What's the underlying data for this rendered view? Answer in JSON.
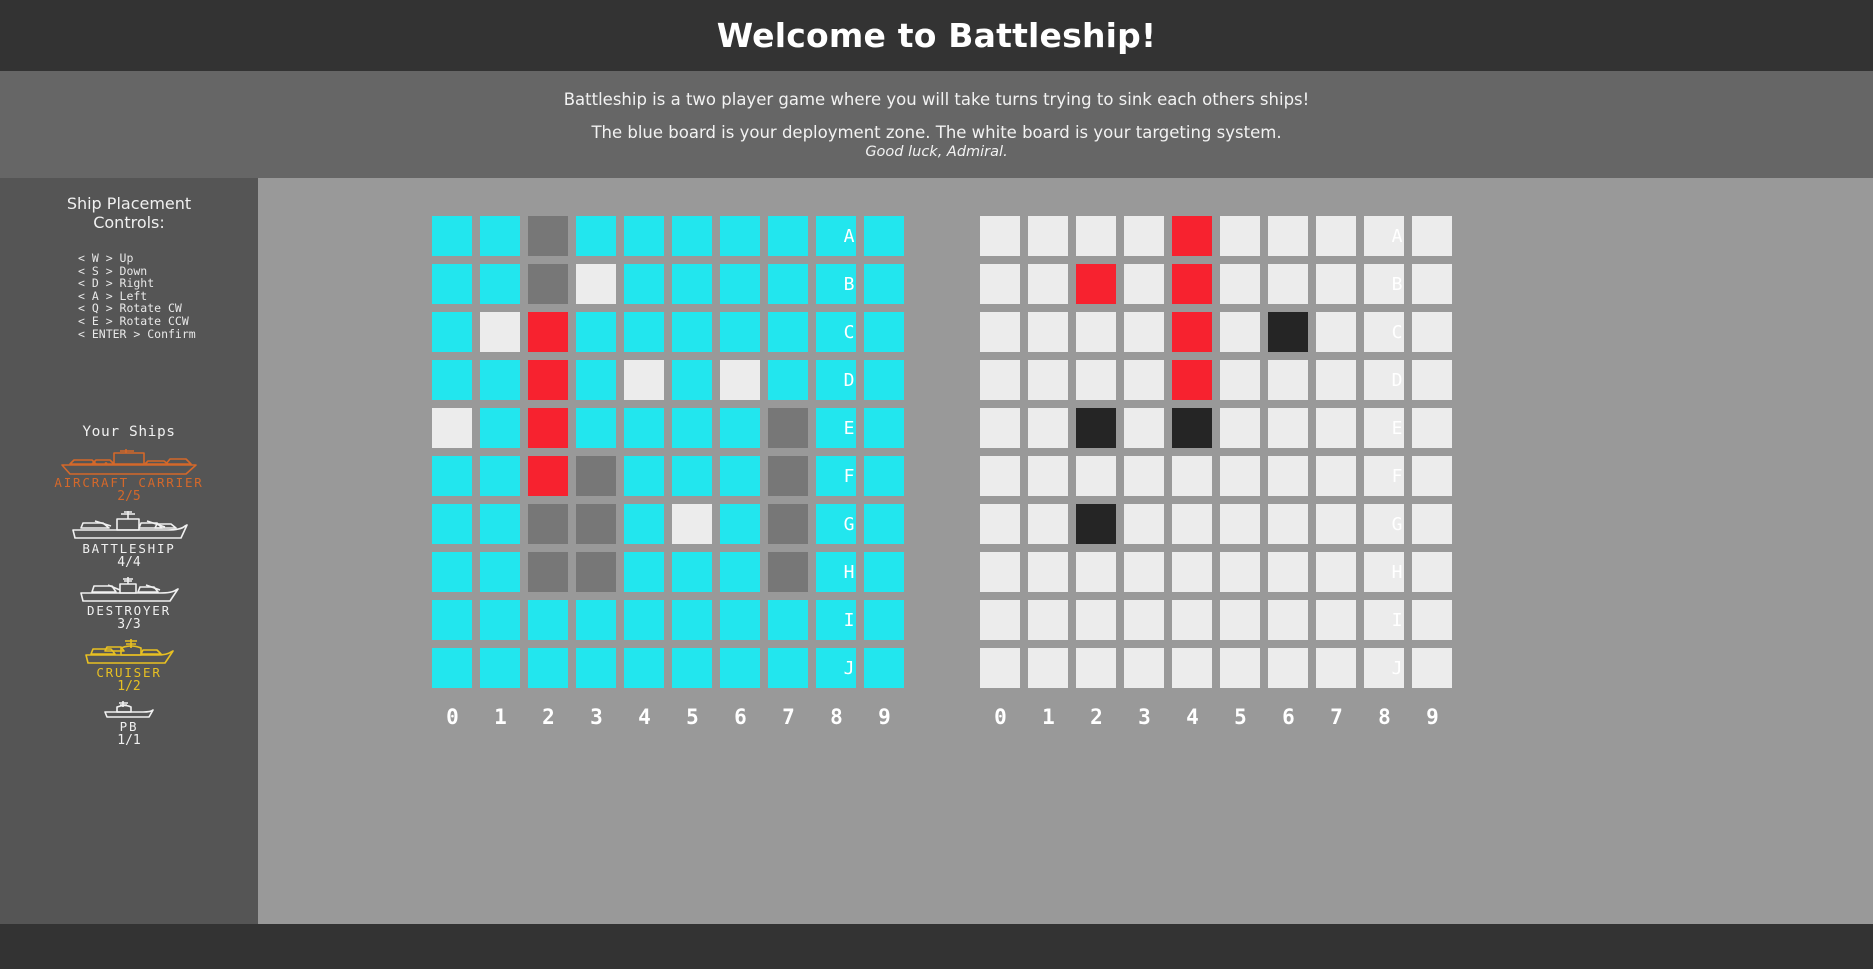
{
  "header": {
    "title": "Welcome to Battleship!"
  },
  "banner": {
    "line1": "Battleship is a two player game where you will take turns trying to sink each others ships!",
    "line2": "The blue board is your deployment zone. The white board is your targeting system.",
    "line3": "Good luck, Admiral."
  },
  "sidebar": {
    "controls_title": "Ship Placement\nControls:",
    "controls_title_line1": "Ship Placement",
    "controls_title_line2": "Controls:",
    "controls": [
      "< W > Up",
      "< S > Down",
      "< D > Right",
      "< A > Left",
      "< Q > Rotate CW",
      "< E > Rotate CCW",
      "< ENTER > Confirm"
    ],
    "ships_title": "Your Ships",
    "ships": [
      {
        "name": "AIRCRAFT CARRIER",
        "count": "2/5",
        "color": "#d4682a",
        "icon": "aircraft-carrier-icon"
      },
      {
        "name": "BATTLESHIP",
        "count": "4/4",
        "color": "#f0f0f0",
        "icon": "battleship-icon"
      },
      {
        "name": "DESTROYER",
        "count": "3/3",
        "color": "#f0f0f0",
        "icon": "destroyer-icon"
      },
      {
        "name": "CRUISER",
        "count": "1/2",
        "color": "#e8c022",
        "icon": "cruiser-icon"
      },
      {
        "name": "PB",
        "count": "1/1",
        "color": "#f0f0f0",
        "icon": "patrol-boat-icon"
      }
    ]
  },
  "colors": {
    "water": "#22e6ee",
    "ship": "#777777",
    "hit": "#f7222f",
    "miss": "#ececec",
    "sunk": "#252525",
    "board_bg": "#999999",
    "header_bg": "#333333",
    "banner_bg": "#666666",
    "sidebar_bg": "#555555"
  },
  "boards": {
    "row_labels": [
      "A",
      "B",
      "C",
      "D",
      "E",
      "F",
      "G",
      "H",
      "I",
      "J"
    ],
    "col_labels": [
      "0",
      "1",
      "2",
      "3",
      "4",
      "5",
      "6",
      "7",
      "8",
      "9"
    ],
    "deployment": {
      "name": "deployment-board",
      "legend": {
        "water": "water",
        "ship": "ship",
        "hit": "hit",
        "miss": "miss"
      },
      "cells": [
        [
          "water",
          "water",
          "ship",
          "water",
          "water",
          "water",
          "water",
          "water",
          "water",
          "water"
        ],
        [
          "water",
          "water",
          "ship",
          "miss",
          "water",
          "water",
          "water",
          "water",
          "water",
          "water"
        ],
        [
          "water",
          "miss",
          "hit",
          "water",
          "water",
          "water",
          "water",
          "water",
          "water",
          "water"
        ],
        [
          "water",
          "water",
          "hit",
          "water",
          "miss",
          "water",
          "miss",
          "water",
          "water",
          "water"
        ],
        [
          "miss",
          "water",
          "hit",
          "water",
          "water",
          "water",
          "water",
          "ship",
          "water",
          "water"
        ],
        [
          "water",
          "water",
          "hit",
          "ship",
          "water",
          "water",
          "water",
          "ship",
          "water",
          "water"
        ],
        [
          "water",
          "water",
          "ship",
          "ship",
          "water",
          "miss",
          "water",
          "ship",
          "water",
          "water"
        ],
        [
          "water",
          "water",
          "ship",
          "ship",
          "water",
          "water",
          "water",
          "ship",
          "water",
          "water"
        ],
        [
          "water",
          "water",
          "water",
          "water",
          "water",
          "water",
          "water",
          "water",
          "water",
          "water"
        ],
        [
          "water",
          "water",
          "water",
          "water",
          "water",
          "water",
          "water",
          "water",
          "water",
          "water"
        ]
      ]
    },
    "targeting": {
      "name": "targeting-board",
      "legend": {
        "empty": "empty",
        "hit": "hit",
        "sunk": "sunk"
      },
      "cells": [
        [
          "empty",
          "empty",
          "empty",
          "empty",
          "hit",
          "empty",
          "empty",
          "empty",
          "empty",
          "empty"
        ],
        [
          "empty",
          "empty",
          "hit",
          "empty",
          "hit",
          "empty",
          "empty",
          "empty",
          "empty",
          "empty"
        ],
        [
          "empty",
          "empty",
          "empty",
          "empty",
          "hit",
          "empty",
          "sunk",
          "empty",
          "empty",
          "empty"
        ],
        [
          "empty",
          "empty",
          "empty",
          "empty",
          "hit",
          "empty",
          "empty",
          "empty",
          "empty",
          "empty"
        ],
        [
          "empty",
          "empty",
          "sunk",
          "empty",
          "sunk",
          "empty",
          "empty",
          "empty",
          "empty",
          "empty"
        ],
        [
          "empty",
          "empty",
          "empty",
          "empty",
          "empty",
          "empty",
          "empty",
          "empty",
          "empty",
          "empty"
        ],
        [
          "empty",
          "empty",
          "sunk",
          "empty",
          "empty",
          "empty",
          "empty",
          "empty",
          "empty",
          "empty"
        ],
        [
          "empty",
          "empty",
          "empty",
          "empty",
          "empty",
          "empty",
          "empty",
          "empty",
          "empty",
          "empty"
        ],
        [
          "empty",
          "empty",
          "empty",
          "empty",
          "empty",
          "empty",
          "empty",
          "empty",
          "empty",
          "empty"
        ],
        [
          "empty",
          "empty",
          "empty",
          "empty",
          "empty",
          "empty",
          "empty",
          "empty",
          "empty",
          "empty"
        ]
      ]
    }
  }
}
